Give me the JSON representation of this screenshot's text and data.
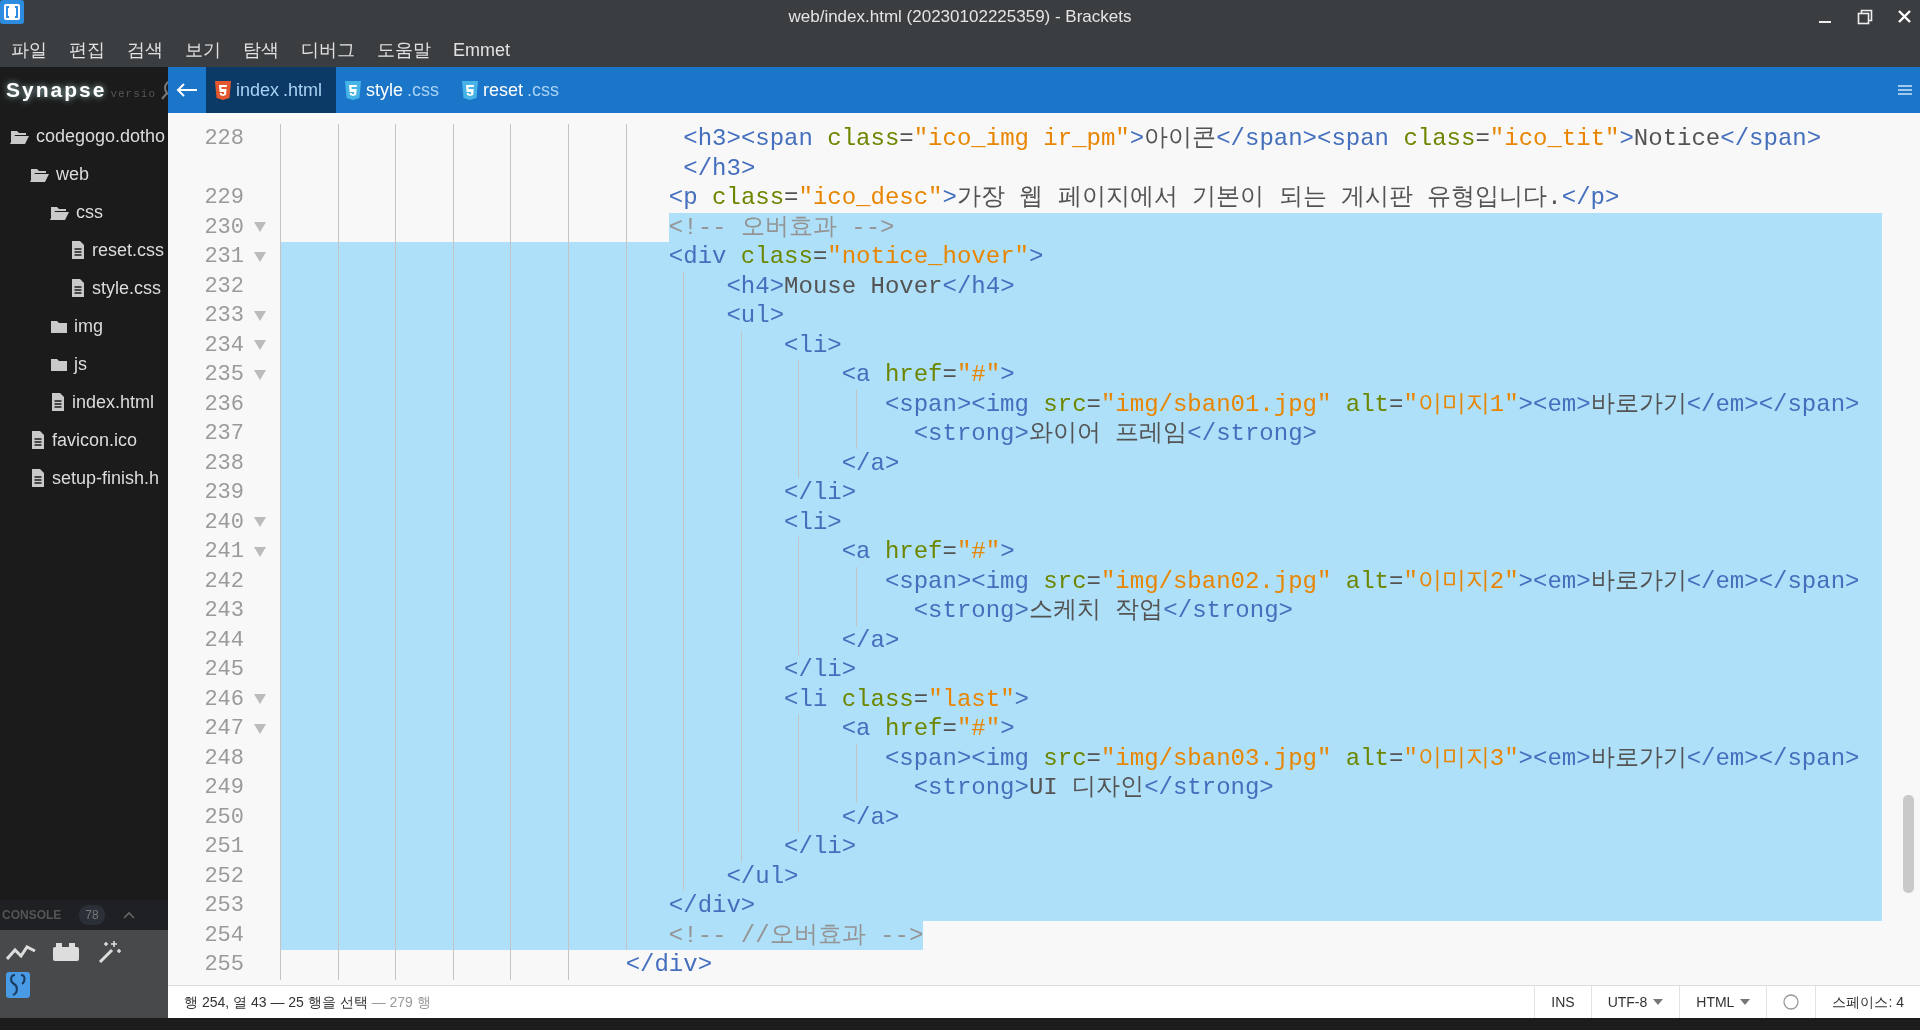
{
  "window": {
    "title": "web/index.html (20230102225359) - Brackets"
  },
  "menu": [
    "파일",
    "편집",
    "검색",
    "보기",
    "탐색",
    "디버그",
    "도움말",
    "Emmet"
  ],
  "sidebar": {
    "logo": "Synapse",
    "version": "versio",
    "tree": [
      {
        "label": "codegogo.dotho",
        "kind": "folder",
        "expanded": true,
        "children": [
          {
            "label": "web",
            "kind": "folder",
            "expanded": true,
            "children": [
              {
                "label": "css",
                "kind": "folder",
                "expanded": true,
                "children": [
                  {
                    "label": "reset.css",
                    "kind": "file"
                  },
                  {
                    "label": "style.css",
                    "kind": "file"
                  }
                ]
              },
              {
                "label": "img",
                "kind": "folder",
                "expanded": false
              },
              {
                "label": "js",
                "kind": "folder",
                "expanded": false
              },
              {
                "label": "index.html",
                "kind": "file"
              }
            ]
          },
          {
            "label": "favicon.ico",
            "kind": "file"
          },
          {
            "label": "setup-finish.h",
            "kind": "file"
          }
        ]
      }
    ]
  },
  "console": {
    "label": "CONSOLE",
    "count": "78"
  },
  "tabs": [
    {
      "name": "index",
      "ext": ".html",
      "kind": "html",
      "selected": true
    },
    {
      "name": "style",
      "ext": ".css",
      "kind": "css",
      "selected": false
    },
    {
      "name": "reset",
      "ext": ".css",
      "kind": "css",
      "selected": false
    }
  ],
  "editor": {
    "lines": [
      {
        "number": "228",
        "fold": false,
        "rows": [
          {
            "margin_selected": false,
            "selected": false,
            "tail_selected": false,
            "tokens": [
              {
                "kind": "tag",
                "text": "                            <h3><span"
              },
              {
                "kind": "attr",
                "text": " class"
              },
              {
                "kind": "text",
                "text": "="
              },
              {
                "kind": "string",
                "text": "\"ico_img ir_pm\""
              },
              {
                "kind": "tag",
                "text": ">"
              },
              {
                "kind": "text",
                "text": "아이콘"
              },
              {
                "kind": "tag",
                "text": "</span><span"
              },
              {
                "kind": "attr",
                "text": " class"
              },
              {
                "kind": "text",
                "text": "="
              },
              {
                "kind": "string",
                "text": "\"ico_tit\""
              },
              {
                "kind": "tag",
                "text": ">"
              },
              {
                "kind": "text",
                "text": "Notice"
              },
              {
                "kind": "tag",
                "text": "</span>"
              }
            ]
          },
          {
            "margin_selected": false,
            "selected": false,
            "tail_selected": false,
            "tokens": [
              {
                "kind": "tag",
                "text": "                            </h3>"
              }
            ]
          }
        ]
      },
      {
        "number": "229",
        "fold": false,
        "rows": [
          {
            "margin_selected": false,
            "selected": false,
            "tail_selected": false,
            "tokens": [
              {
                "kind": "tag",
                "text": "                           <p"
              },
              {
                "kind": "attr",
                "text": " class"
              },
              {
                "kind": "text",
                "text": "="
              },
              {
                "kind": "string",
                "text": "\"ico_desc\""
              },
              {
                "kind": "tag",
                "text": ">"
              },
              {
                "kind": "text",
                "text": "가장 웹 페이지에서 기본이 되는 게시판 유형입니다."
              },
              {
                "kind": "tag",
                "text": "</p>"
              }
            ]
          }
        ]
      },
      {
        "number": "230",
        "fold": true,
        "rows": [
          {
            "margin_selected": false,
            "selected": true,
            "tail_selected": true,
            "tokens": [
              {
                "kind": "comment",
                "text": "                           <!-- 오버효과 -->"
              }
            ]
          }
        ]
      },
      {
        "number": "231",
        "fold": true,
        "rows": [
          {
            "margin_selected": true,
            "selected": true,
            "tail_selected": true,
            "tokens": [
              {
                "kind": "tag",
                "text": "                           <div"
              },
              {
                "kind": "attr",
                "text": " class"
              },
              {
                "kind": "text",
                "text": "="
              },
              {
                "kind": "string",
                "text": "\"notice_hover\""
              },
              {
                "kind": "tag",
                "text": ">"
              }
            ]
          }
        ]
      },
      {
        "number": "232",
        "fold": false,
        "rows": [
          {
            "margin_selected": true,
            "selected": true,
            "tail_selected": true,
            "tokens": [
              {
                "kind": "tag",
                "text": "                               <h4>"
              },
              {
                "kind": "text",
                "text": "Mouse Hover"
              },
              {
                "kind": "tag",
                "text": "</h4>"
              }
            ]
          }
        ]
      },
      {
        "number": "233",
        "fold": true,
        "rows": [
          {
            "margin_selected": true,
            "selected": true,
            "tail_selected": true,
            "tokens": [
              {
                "kind": "tag",
                "text": "                               <ul>"
              }
            ]
          }
        ]
      },
      {
        "number": "234",
        "fold": true,
        "rows": [
          {
            "margin_selected": true,
            "selected": true,
            "tail_selected": true,
            "tokens": [
              {
                "kind": "tag",
                "text": "                                   <li>"
              }
            ]
          }
        ]
      },
      {
        "number": "235",
        "fold": true,
        "rows": [
          {
            "margin_selected": true,
            "selected": true,
            "tail_selected": true,
            "tokens": [
              {
                "kind": "tag",
                "text": "                                       <a"
              },
              {
                "kind": "attr",
                "text": " href"
              },
              {
                "kind": "text",
                "text": "="
              },
              {
                "kind": "string",
                "text": "\"#\""
              },
              {
                "kind": "tag",
                "text": ">"
              }
            ]
          }
        ]
      },
      {
        "number": "236",
        "fold": false,
        "rows": [
          {
            "margin_selected": true,
            "selected": true,
            "tail_selected": true,
            "tokens": [
              {
                "kind": "tag",
                "text": "                                          <span><img"
              },
              {
                "kind": "attr",
                "text": " src"
              },
              {
                "kind": "text",
                "text": "="
              },
              {
                "kind": "string",
                "text": "\"img/sban01.jpg\""
              },
              {
                "kind": "attr",
                "text": " alt"
              },
              {
                "kind": "text",
                "text": "="
              },
              {
                "kind": "string",
                "text": "\"이미지1\""
              },
              {
                "kind": "tag",
                "text": "><em>"
              },
              {
                "kind": "text",
                "text": "바로가기"
              },
              {
                "kind": "tag",
                "text": "</em></span>"
              }
            ]
          }
        ]
      },
      {
        "number": "237",
        "fold": false,
        "rows": [
          {
            "margin_selected": true,
            "selected": true,
            "tail_selected": true,
            "tokens": [
              {
                "kind": "tag",
                "text": "                                            <strong>"
              },
              {
                "kind": "text",
                "text": "와이어 프레임"
              },
              {
                "kind": "tag",
                "text": "</strong>"
              }
            ]
          }
        ]
      },
      {
        "number": "238",
        "fold": false,
        "rows": [
          {
            "margin_selected": true,
            "selected": true,
            "tail_selected": true,
            "tokens": [
              {
                "kind": "tag",
                "text": "                                       </a>"
              }
            ]
          }
        ]
      },
      {
        "number": "239",
        "fold": false,
        "rows": [
          {
            "margin_selected": true,
            "selected": true,
            "tail_selected": true,
            "tokens": [
              {
                "kind": "tag",
                "text": "                                   </li>"
              }
            ]
          }
        ]
      },
      {
        "number": "240",
        "fold": true,
        "rows": [
          {
            "margin_selected": true,
            "selected": true,
            "tail_selected": true,
            "tokens": [
              {
                "kind": "tag",
                "text": "                                   <li>"
              }
            ]
          }
        ]
      },
      {
        "number": "241",
        "fold": true,
        "rows": [
          {
            "margin_selected": true,
            "selected": true,
            "tail_selected": true,
            "tokens": [
              {
                "kind": "tag",
                "text": "                                       <a"
              },
              {
                "kind": "attr",
                "text": " href"
              },
              {
                "kind": "text",
                "text": "="
              },
              {
                "kind": "string",
                "text": "\"#\""
              },
              {
                "kind": "tag",
                "text": ">"
              }
            ]
          }
        ]
      },
      {
        "number": "242",
        "fold": false,
        "rows": [
          {
            "margin_selected": true,
            "selected": true,
            "tail_selected": true,
            "tokens": [
              {
                "kind": "tag",
                "text": "                                          <span><img"
              },
              {
                "kind": "attr",
                "text": " src"
              },
              {
                "kind": "text",
                "text": "="
              },
              {
                "kind": "string",
                "text": "\"img/sban02.jpg\""
              },
              {
                "kind": "attr",
                "text": " alt"
              },
              {
                "kind": "text",
                "text": "="
              },
              {
                "kind": "string",
                "text": "\"이미지2\""
              },
              {
                "kind": "tag",
                "text": "><em>"
              },
              {
                "kind": "text",
                "text": "바로가기"
              },
              {
                "kind": "tag",
                "text": "</em></span>"
              }
            ]
          }
        ]
      },
      {
        "number": "243",
        "fold": false,
        "rows": [
          {
            "margin_selected": true,
            "selected": true,
            "tail_selected": true,
            "tokens": [
              {
                "kind": "tag",
                "text": "                                            <strong>"
              },
              {
                "kind": "text",
                "text": "스케치 작업"
              },
              {
                "kind": "tag",
                "text": "</strong>"
              }
            ]
          }
        ]
      },
      {
        "number": "244",
        "fold": false,
        "rows": [
          {
            "margin_selected": true,
            "selected": true,
            "tail_selected": true,
            "tokens": [
              {
                "kind": "tag",
                "text": "                                       </a>"
              }
            ]
          }
        ]
      },
      {
        "number": "245",
        "fold": false,
        "rows": [
          {
            "margin_selected": true,
            "selected": true,
            "tail_selected": true,
            "tokens": [
              {
                "kind": "tag",
                "text": "                                   </li>"
              }
            ]
          }
        ]
      },
      {
        "number": "246",
        "fold": true,
        "rows": [
          {
            "margin_selected": true,
            "selected": true,
            "tail_selected": true,
            "tokens": [
              {
                "kind": "tag",
                "text": "                                   <li"
              },
              {
                "kind": "attr",
                "text": " class"
              },
              {
                "kind": "text",
                "text": "="
              },
              {
                "kind": "string",
                "text": "\"last\""
              },
              {
                "kind": "tag",
                "text": ">"
              }
            ]
          }
        ]
      },
      {
        "number": "247",
        "fold": true,
        "rows": [
          {
            "margin_selected": true,
            "selected": true,
            "tail_selected": true,
            "tokens": [
              {
                "kind": "tag",
                "text": "                                       <a"
              },
              {
                "kind": "attr",
                "text": " href"
              },
              {
                "kind": "text",
                "text": "="
              },
              {
                "kind": "string",
                "text": "\"#\""
              },
              {
                "kind": "tag",
                "text": ">"
              }
            ]
          }
        ]
      },
      {
        "number": "248",
        "fold": false,
        "rows": [
          {
            "margin_selected": true,
            "selected": true,
            "tail_selected": true,
            "tokens": [
              {
                "kind": "tag",
                "text": "                                          <span><img"
              },
              {
                "kind": "attr",
                "text": " src"
              },
              {
                "kind": "text",
                "text": "="
              },
              {
                "kind": "string",
                "text": "\"img/sban03.jpg\""
              },
              {
                "kind": "attr",
                "text": " alt"
              },
              {
                "kind": "text",
                "text": "="
              },
              {
                "kind": "string",
                "text": "\"이미지3\""
              },
              {
                "kind": "tag",
                "text": "><em>"
              },
              {
                "kind": "text",
                "text": "바로가기"
              },
              {
                "kind": "tag",
                "text": "</em></span>"
              }
            ]
          }
        ]
      },
      {
        "number": "249",
        "fold": false,
        "rows": [
          {
            "margin_selected": true,
            "selected": true,
            "tail_selected": true,
            "tokens": [
              {
                "kind": "tag",
                "text": "                                            <strong>"
              },
              {
                "kind": "text",
                "text": "UI 디자인"
              },
              {
                "kind": "tag",
                "text": "</strong>"
              }
            ]
          }
        ]
      },
      {
        "number": "250",
        "fold": false,
        "rows": [
          {
            "margin_selected": true,
            "selected": true,
            "tail_selected": true,
            "tokens": [
              {
                "kind": "tag",
                "text": "                                       </a>"
              }
            ]
          }
        ]
      },
      {
        "number": "251",
        "fold": false,
        "rows": [
          {
            "margin_selected": true,
            "selected": true,
            "tail_selected": true,
            "tokens": [
              {
                "kind": "tag",
                "text": "                                   </li>"
              }
            ]
          }
        ]
      },
      {
        "number": "252",
        "fold": false,
        "rows": [
          {
            "margin_selected": true,
            "selected": true,
            "tail_selected": true,
            "tokens": [
              {
                "kind": "tag",
                "text": "                               </ul>"
              }
            ]
          }
        ]
      },
      {
        "number": "253",
        "fold": false,
        "rows": [
          {
            "margin_selected": true,
            "selected": true,
            "tail_selected": true,
            "tokens": [
              {
                "kind": "tag",
                "text": "                           </div>"
              }
            ]
          }
        ]
      },
      {
        "number": "254",
        "fold": false,
        "rows": [
          {
            "margin_selected": true,
            "selected": true,
            "tail_selected": false,
            "tokens": [
              {
                "kind": "comment",
                "text": "                           <!-- //오버효과 -->"
              }
            ]
          }
        ]
      },
      {
        "number": "255",
        "fold": false,
        "rows": [
          {
            "margin_selected": false,
            "selected": false,
            "tail_selected": false,
            "tokens": [
              {
                "kind": "tag",
                "text": "                        </div>"
              }
            ]
          }
        ]
      }
    ]
  },
  "status_bar": {
    "position": "행 254, 열 43 — 25 행을 선택",
    "total": "— 279 행",
    "mode": "INS",
    "encoding": "UTF-8",
    "language": "HTML",
    "indent": "스페이스: 4"
  }
}
